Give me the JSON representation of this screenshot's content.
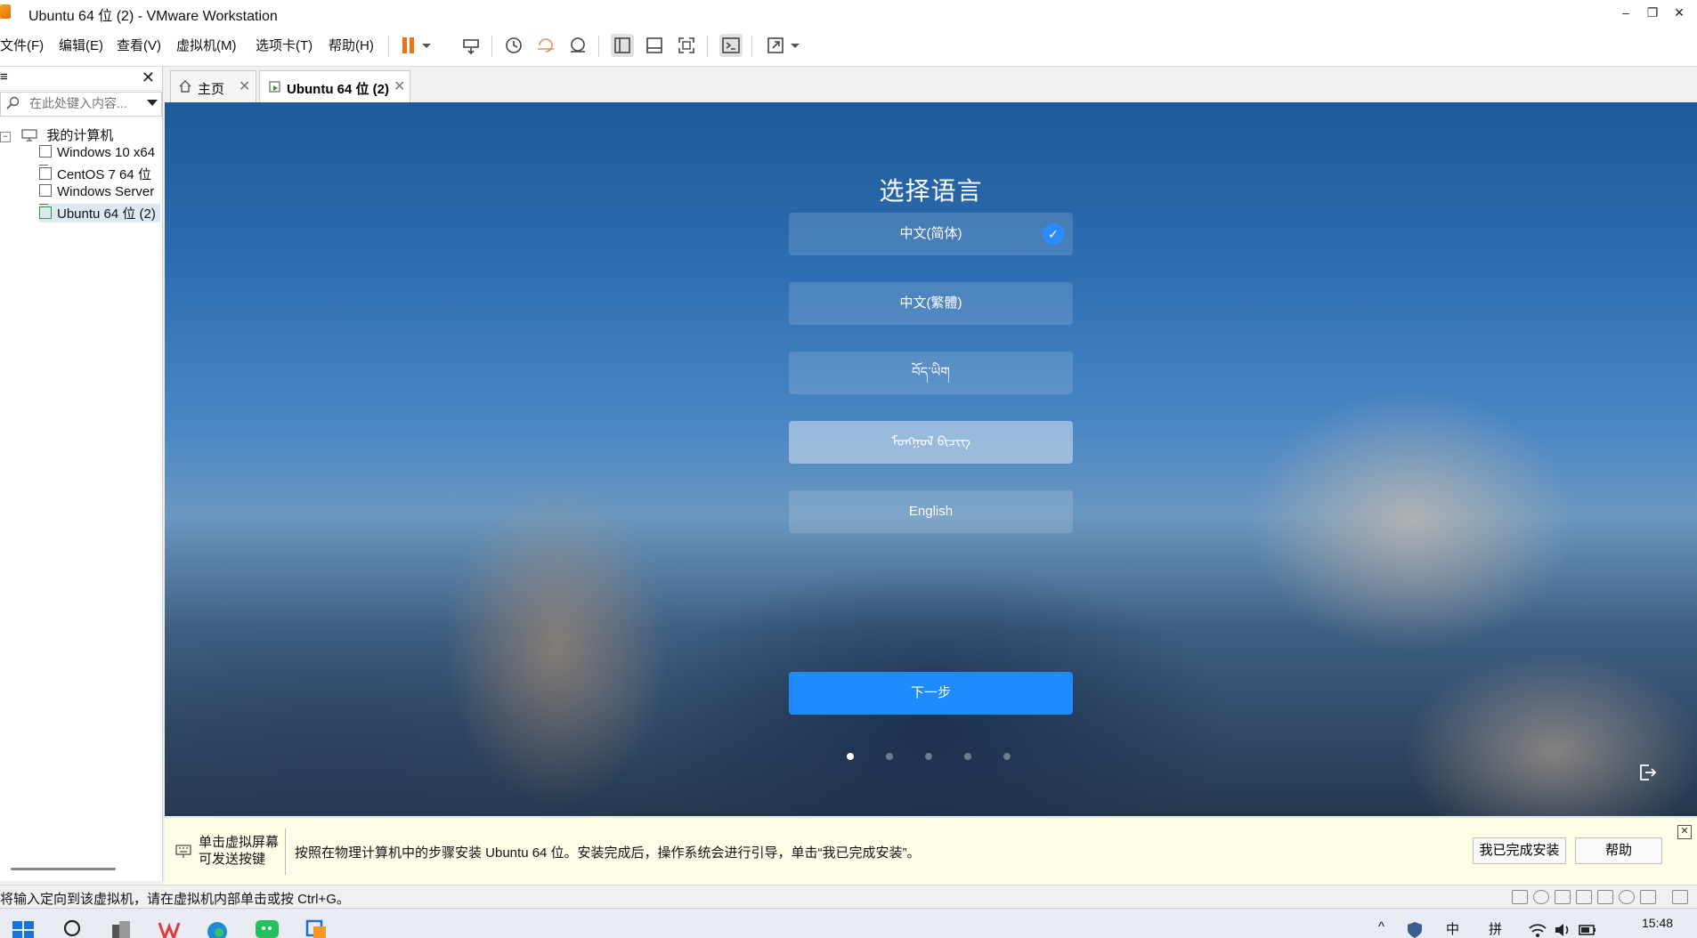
{
  "window": {
    "title": "Ubuntu 64 位 (2) - VMware Workstation",
    "controls": {
      "minimize": "–",
      "restore": "❐",
      "close": "✕"
    }
  },
  "menu": {
    "items": [
      "文件(F)",
      "编辑(E)",
      "查看(V)",
      "虚拟机(M)",
      "选项卡(T)",
      "帮助(H)"
    ]
  },
  "toolbar": {
    "icons": [
      "pause-icon",
      "send-ctrl-alt-del-icon",
      "snapshot-icon",
      "revert-snapshot-icon",
      "snapshot-manager-icon",
      "show-library-icon",
      "thumbnail-bar-icon",
      "fullscreen-icon",
      "console-icon",
      "stretch-icon"
    ]
  },
  "sidebar": {
    "header_glyph": "≡",
    "close": "✕",
    "search_placeholder": "在此处键入内容...",
    "root": "我的计算机",
    "vms": [
      "Windows 10 x64",
      "CentOS 7 64 位",
      "Windows Server",
      "Ubuntu 64 位 (2)"
    ]
  },
  "tabs": [
    {
      "label": "主页",
      "close": "✕"
    },
    {
      "label": "Ubuntu 64 位 (2)",
      "close": "✕"
    }
  ],
  "installer": {
    "title": "选择语言",
    "languages": [
      "中文(简体)",
      "中文(繁體)",
      "བོད་ཡིག",
      "ᠮᠣᠩᠭᠣᠯ ᠪᠢᠴᠢᠭ",
      "English"
    ],
    "selected_index": 0,
    "check": "✓",
    "next_label": "下一步",
    "steps_total": 5,
    "current_step": 1
  },
  "hint": {
    "left_line1": "单击虚拟屏幕",
    "left_line2": "可发送按键",
    "text": "按照在物理计算机中的步骤安装 Ubuntu 64 位。安装完成后，操作系统会进行引导，单击“我已完成安装”。",
    "done_button": "我已完成安装",
    "help_button": "帮助",
    "close": "✕"
  },
  "status": {
    "text": "将输入定向到该虚拟机，请在虚拟机内部单击或按 Ctrl+G。"
  },
  "taskbar": {
    "ime_1": "中",
    "ime_2": "拼",
    "chevron": "^",
    "clock": "15:48"
  },
  "colors": {
    "accent": "#1e8bff",
    "check": "#2b8cff",
    "hint_bg": "#fdfde8",
    "pause": "#e8741a"
  }
}
